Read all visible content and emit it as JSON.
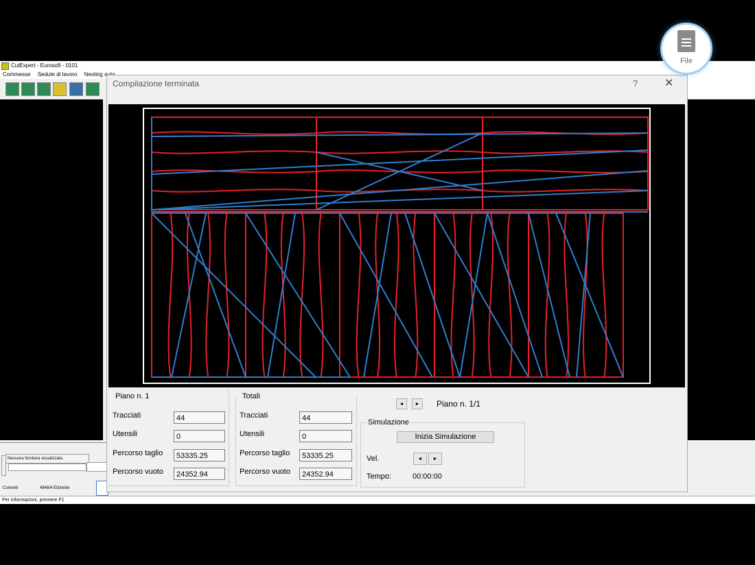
{
  "app": {
    "title": "CutExpert - Eurosoft - 0101",
    "menu": [
      "Commesse",
      "Sedute di lavoro",
      "Nesting auto"
    ],
    "status_left_1": "Nessuna fornitura visualizzata",
    "status_left_2": "Connetti",
    "status_left_3": "4848/4 Etichette",
    "statusbar_text": "Per informazioni, premere F1"
  },
  "file_badge": {
    "label": "File",
    "icon": "document-icon"
  },
  "dialog": {
    "title": "Compilazione terminata",
    "help_label": "?",
    "close_label": "✕",
    "piano": {
      "heading": "Piano n. 1",
      "tracciati_label": "Tracciati",
      "tracciati_value": "44",
      "utensili_label": "Utensili",
      "utensili_value": "0",
      "percorso_taglio_label": "Percorso taglio",
      "percorso_taglio_value": "53335.25",
      "percorso_vuoto_label": "Percorso vuoto",
      "percorso_vuoto_value": "24352.94"
    },
    "totali": {
      "heading": "Totali",
      "tracciati_label": "Tracciati",
      "tracciati_value": "44",
      "utensili_label": "Utensili",
      "utensili_value": "0",
      "percorso_taglio_label": "Percorso taglio",
      "percorso_taglio_value": "53335.25",
      "percorso_vuoto_label": "Percorso vuoto",
      "percorso_vuoto_value": "24352.94"
    },
    "nav": {
      "prev_label": "◄",
      "next_label": "►",
      "piano_label": "Piano n. 1/1"
    },
    "simulazione": {
      "heading": "Simulazione",
      "start_label": "Inizia Simulazione",
      "vel_label": "Vel.",
      "vel_minus": "◄",
      "vel_plus": "►",
      "tempo_label": "Tempo:",
      "tempo_value": "00:00:00"
    }
  },
  "colors": {
    "cut": "#e8202a",
    "travel": "#2f7fd0",
    "background": "#000000"
  }
}
